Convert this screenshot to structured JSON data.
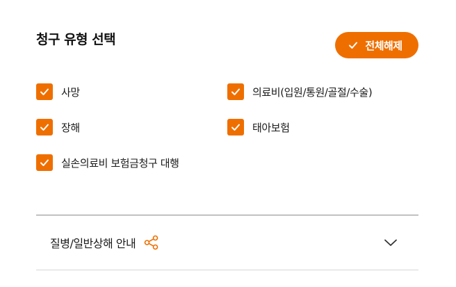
{
  "section": {
    "title": "청구 유형 선택",
    "select_all_label": "전체해제"
  },
  "options": [
    {
      "label": "사망",
      "checked": true
    },
    {
      "label": "의료비(입원/통원/골절/수술)",
      "checked": true
    },
    {
      "label": "장해",
      "checked": true
    },
    {
      "label": "태아보험",
      "checked": true
    },
    {
      "label": "실손의료비 보험금청구 대행",
      "checked": true
    }
  ],
  "accordion": {
    "title": "질병/일반상해 안내",
    "expanded": false
  },
  "colors": {
    "accent": "#ee6f00",
    "divider_top": "#8a8a8a",
    "divider_bottom": "#d6d6d6"
  },
  "icons": {
    "checkmark": "check-icon",
    "share": "share-icon",
    "chevron": "chevron-down-icon"
  }
}
